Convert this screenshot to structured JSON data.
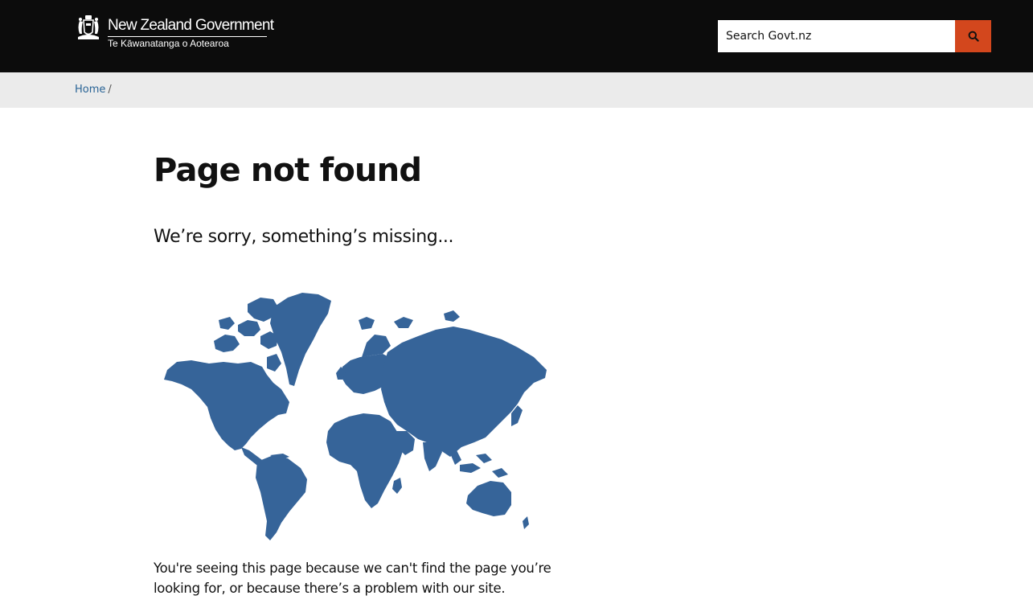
{
  "header": {
    "logo": {
      "english": "New Zealand Government",
      "maori": "Te Kāwanatanga o Aotearoa"
    },
    "search": {
      "placeholder": "Search Govt.nz",
      "button_icon": "search-icon"
    }
  },
  "breadcrumb": {
    "items": [
      {
        "label": "Home"
      }
    ],
    "separator": "/"
  },
  "main": {
    "title": "Page not found",
    "subtitle": "We’re sorry, something’s missing...",
    "illustration": "world-map-icon",
    "body": "You're seeing this page because we can't find the page you’re looking for, or because there’s a problem with our site."
  },
  "colors": {
    "header_bg": "#0c0c0c",
    "search_button": "#d3471d",
    "breadcrumb_bg": "#ebebeb",
    "link": "#2a6496",
    "map_fill": "#366499"
  }
}
